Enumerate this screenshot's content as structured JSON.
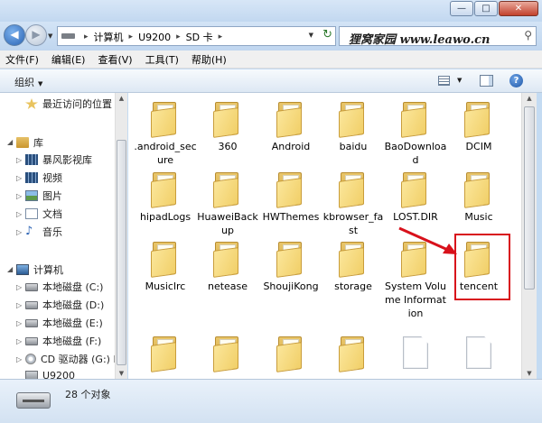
{
  "window": {
    "minimize_glyph": "—",
    "maximize_glyph": "□",
    "close_glyph": "✕"
  },
  "address": {
    "breadcrumbs": [
      "计算机",
      "U9200",
      "SD 卡"
    ],
    "watermark": "狸窝家园 www.leawo.cn"
  },
  "menu": [
    "文件(F)",
    "编辑(E)",
    "查看(V)",
    "工具(T)",
    "帮助(H)"
  ],
  "toolbar": {
    "organize": "组织"
  },
  "sidebar": {
    "recent": "最近访问的位置",
    "library": "库",
    "library_items": [
      "暴风影视库",
      "视频",
      "图片",
      "文档",
      "音乐"
    ],
    "computer": "计算机",
    "drives": [
      "本地磁盘 (C:)",
      "本地磁盘 (D:)",
      "本地磁盘 (E:)",
      "本地磁盘 (F:)",
      "CD 驱动器 (G:) H",
      "U9200"
    ]
  },
  "files": [
    ".android_secure",
    "360",
    "Android",
    "baidu",
    "BaoDownload",
    "DCIM",
    "hipadLogs",
    "HuaweiBackup",
    "HWThemes",
    "kbrowser_fast",
    "LOST.DIR",
    "Music",
    "Musiclrc",
    "netease",
    "ShoujiKong",
    "storage",
    "System Volume Information",
    "tencent",
    "",
    "",
    "",
    "",
    "",
    ""
  ],
  "file_icons": [
    "folder",
    "folder",
    "folder",
    "folder",
    "folder",
    "folder",
    "folder",
    "folder",
    "folder",
    "folder",
    "folder",
    "folder",
    "folder",
    "folder",
    "folder",
    "folder",
    "folder",
    "folder",
    "folder",
    "folder",
    "folder",
    "folder",
    "file",
    "file"
  ],
  "status": {
    "count": "28 个对象"
  },
  "colors": {
    "highlight": "#d8111b",
    "folder": "#f1cf68"
  }
}
